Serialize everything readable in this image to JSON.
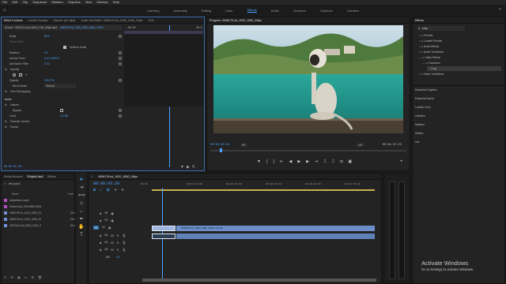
{
  "menu": [
    "File",
    "Edit",
    "Clip",
    "Sequence",
    "Markers",
    "Graphics",
    "View",
    "Window",
    "Help"
  ],
  "workspaces": {
    "items": [
      "Learning",
      "Assembly",
      "Editing",
      "Color",
      "Effects",
      "Audio",
      "Graphics",
      "Captions",
      "Libraries"
    ],
    "active": "Effects"
  },
  "effect_controls": {
    "tabs": [
      "Effect Controls",
      "Lumetri Scopes",
      "Source: (no clips)",
      "Audio Clip Mixer: 4548176-hd_1920_1080_24fps",
      "Text"
    ],
    "source_label": "Source * 4575113-uhd_3840_2160_30fps.mp4",
    "clip_label": "4548176-hd_1920_1080_24fps * 4575",
    "ruler_start": ":00:00",
    "ruler_end": "00:0",
    "rows": [
      {
        "label": "Scale",
        "value": "80.0"
      },
      {
        "label": "Scale Width",
        "value": ""
      },
      {
        "label": "Uniform Scale",
        "value": ""
      },
      {
        "label": "Rotation",
        "value": "0.0"
      },
      {
        "label": "Anchor Point",
        "value": "0.0.0     1000.0"
      },
      {
        "label": "Anti-flicker Filter",
        "value": "0.00"
      },
      {
        "label": "Opacity",
        "value": ""
      },
      {
        "label": "Opacity",
        "value": "100.0 %"
      },
      {
        "label": "Blend Mode",
        "value": "Normal"
      },
      {
        "label": "Time Remapping",
        "value": ""
      },
      {
        "label": "Audio",
        "value": ""
      },
      {
        "label": "Volume",
        "value": ""
      },
      {
        "label": "Bypass",
        "value": ""
      },
      {
        "label": "Level",
        "value": "0.0 dB"
      },
      {
        "label": "Channel Volume",
        "value": ""
      },
      {
        "label": "Panner",
        "value": ""
      }
    ],
    "timecode": "00:00:05:20"
  },
  "program": {
    "title": "Program: 4548176-hd_1920_1080_24fps",
    "timecode": "00:00:05:20",
    "fit": "Fit",
    "quality": "1/2",
    "duration": "00:01:47:23"
  },
  "effects_panel": {
    "title": "Effects",
    "search_value": "crop",
    "tree": [
      "Presets",
      "Lumetri Presets",
      "Audio Effects",
      "Audio Transitions",
      "Video Effects",
      "Transform",
      "Crop",
      "Video Transitions"
    ],
    "sections": [
      "Essential Graphics",
      "Essential Sound",
      "Lumetri Color",
      "Libraries",
      "Markers",
      "History",
      "Info"
    ]
  },
  "project": {
    "tabs": [
      "Media Browser",
      "Project: test",
      "Effects"
    ],
    "name": "test.prproj",
    "col_name": "Name",
    "col_rate": "Fram",
    "items": [
      {
        "name": "Adjustment Layer",
        "rate": "",
        "color": "#b14fc0"
      },
      {
        "name": "Screenshot_20230605-0526",
        "rate": "",
        "color": "#b14fc0"
      },
      {
        "name": "4548176-hd_1920_1080_24",
        "rate": "24.0",
        "color": "#6f8fd8"
      },
      {
        "name": "4548176-hd_1920_1080_24",
        "rate": "24.0",
        "color": "#6f8fd8"
      },
      {
        "name": "4575113-uhd_3840_2160_3",
        "rate": "25.0",
        "color": "#6f8fd8"
      }
    ]
  },
  "timeline": {
    "title": "4548176-hd_1920_1080_24fps",
    "timecode": "00:00:05:20",
    "ruler": [
      "00:00",
      "00:00:10:00",
      "00:00:20:00",
      "00:00:30:00",
      "00:00:40:00",
      "00:00:50:00",
      "00:01:00:00"
    ],
    "tracks": [
      "V3",
      "V2",
      "V1",
      "A1",
      "A2",
      "A3"
    ],
    "clip_label": "4548176-hd_1920_1080_24fps.mp4 [V]",
    "mix_label": "Mix",
    "mix_value": "0.0"
  },
  "watermark": {
    "title": "Activate Windows",
    "subtitle": "Go to Settings to activate Windows."
  }
}
